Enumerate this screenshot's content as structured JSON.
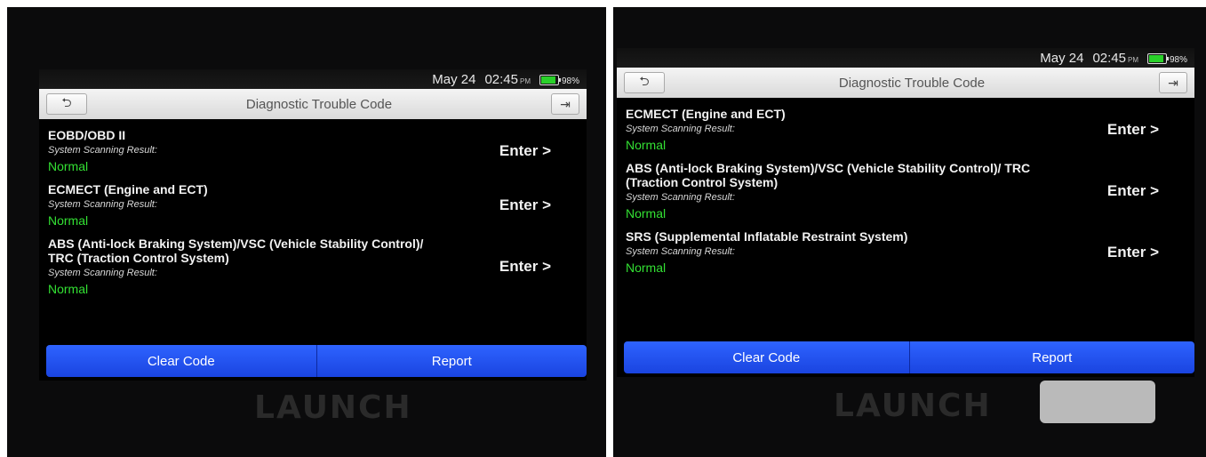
{
  "statusbar": {
    "date": "May 24",
    "time": "02:45",
    "ampm": "PM",
    "battery": "98%"
  },
  "title": "Diagnostic Trouble Code",
  "left_panel": {
    "items": [
      {
        "name": "EOBD/OBD II",
        "sub": "System Scanning Result:",
        "status": "Normal",
        "action": "Enter >"
      },
      {
        "name": "ECMECT (Engine and ECT)",
        "sub": "System Scanning Result:",
        "status": "Normal",
        "action": "Enter >"
      },
      {
        "name": "ABS (Anti-lock Braking System)/VSC (Vehicle Stability Control)/ TRC (Traction Control System)",
        "sub": "System Scanning Result:",
        "status": "Normal",
        "action": "Enter >"
      }
    ]
  },
  "right_panel": {
    "items": [
      {
        "name": "ECMECT (Engine and ECT)",
        "sub": "System Scanning Result:",
        "status": "Normal",
        "action": "Enter >"
      },
      {
        "name": "ABS (Anti-lock Braking System)/VSC (Vehicle Stability Control)/ TRC (Traction Control System)",
        "sub": "System Scanning Result:",
        "status": "Normal",
        "action": "Enter >"
      },
      {
        "name": "SRS (Supplemental Inflatable Restraint System)",
        "sub": "System Scanning Result:",
        "status": "Normal",
        "action": "Enter >"
      }
    ]
  },
  "buttons": {
    "clear": "Clear Code",
    "report": "Report"
  },
  "brand": "LAUNCH",
  "icons": {
    "back": "back-arrow-icon",
    "exit": "exit-icon"
  },
  "colors": {
    "normal": "#33e033",
    "button_blue": "#2e63ff"
  }
}
